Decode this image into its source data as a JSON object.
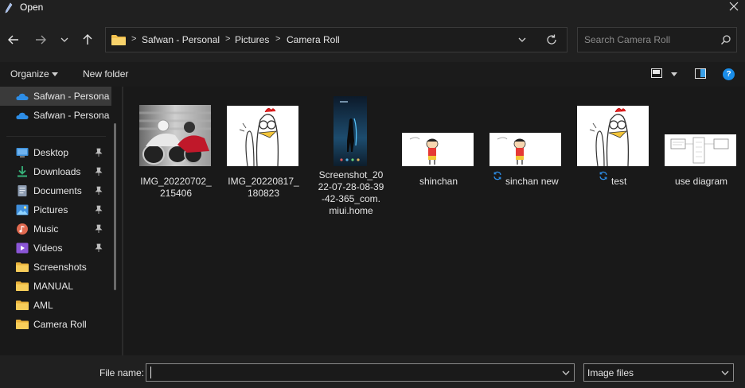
{
  "window": {
    "title": "Open"
  },
  "nav": {
    "back_icon": "arrow-left-icon",
    "forward_icon": "arrow-right-icon",
    "recent_icon": "chevron-down-icon",
    "up_icon": "arrow-up-icon"
  },
  "address": {
    "crumbs": [
      "Safwan - Personal",
      "Pictures",
      "Camera Roll"
    ],
    "separator": ">"
  },
  "search": {
    "placeholder": "Search Camera Roll"
  },
  "toolbar": {
    "organize_label": "Organize",
    "new_folder_label": "New folder",
    "help_label": "?"
  },
  "sidebar": {
    "items": [
      {
        "label": "Safwan - Persona",
        "icon": "onedrive-cloud-icon",
        "selected": true,
        "pinned": false
      },
      {
        "label": "Safwan - Persona",
        "icon": "onedrive-cloud-icon",
        "selected": false,
        "pinned": false
      },
      {
        "label": "Desktop",
        "icon": "desktop-icon",
        "selected": false,
        "pinned": true
      },
      {
        "label": "Downloads",
        "icon": "download-icon",
        "selected": false,
        "pinned": true
      },
      {
        "label": "Documents",
        "icon": "documents-icon",
        "selected": false,
        "pinned": true
      },
      {
        "label": "Pictures",
        "icon": "pictures-icon",
        "selected": false,
        "pinned": true
      },
      {
        "label": "Music",
        "icon": "music-icon",
        "selected": false,
        "pinned": true
      },
      {
        "label": "Videos",
        "icon": "videos-icon",
        "selected": false,
        "pinned": true
      },
      {
        "label": "Screenshots",
        "icon": "folder-icon",
        "selected": false,
        "pinned": false
      },
      {
        "label": "MANUAL",
        "icon": "folder-icon",
        "selected": false,
        "pinned": false
      },
      {
        "label": "AML",
        "icon": "folder-icon",
        "selected": false,
        "pinned": false
      },
      {
        "label": "Camera Roll",
        "icon": "folder-icon",
        "selected": false,
        "pinned": false
      }
    ]
  },
  "files": [
    {
      "name_lines": [
        "IMG_20220702_",
        "215406"
      ],
      "thumb": "motorcycle-photo",
      "sync": false
    },
    {
      "name_lines": [
        "IMG_20220817_",
        "180823"
      ],
      "thumb": "chicken-drawing",
      "sync": false
    },
    {
      "name_lines": [
        "Screenshot_20",
        "22-07-28-08-39",
        "-42-365_com.",
        "miui.home"
      ],
      "thumb": "phone-screenshot",
      "sync": false
    },
    {
      "name_lines": [
        "shinchan"
      ],
      "thumb": "shinchan-drawing",
      "sync": false
    },
    {
      "name_lines": [
        "sinchan new"
      ],
      "thumb": "shinchan-drawing",
      "sync": true
    },
    {
      "name_lines": [
        "test"
      ],
      "thumb": "chicken-drawing",
      "sync": true
    },
    {
      "name_lines": [
        "use diagram"
      ],
      "thumb": "diagram-sketch",
      "sync": false
    }
  ],
  "bottom": {
    "filename_label": "File name:",
    "filename_value": "",
    "filetype_value": "Image files"
  },
  "colors": {
    "accent": "#1a8de8",
    "folder": "#f2c14e",
    "background": "#191919"
  }
}
